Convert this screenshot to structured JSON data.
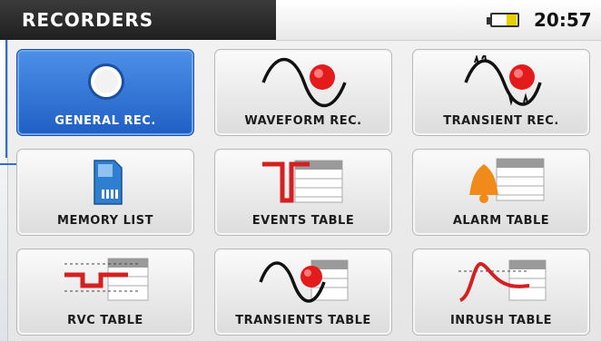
{
  "header": {
    "title": "RECORDERS",
    "time": "20:57",
    "battery_icon": "battery-icon"
  },
  "tiles": [
    {
      "label": "GENERAL REC.",
      "icon": "general-record-icon",
      "selected": true
    },
    {
      "label": "WAVEFORM REC.",
      "icon": "waveform-record-icon"
    },
    {
      "label": "TRANSIENT REC.",
      "icon": "transient-record-icon"
    },
    {
      "label": "MEMORY LIST",
      "icon": "memory-card-icon"
    },
    {
      "label": "EVENTS TABLE",
      "icon": "events-table-icon"
    },
    {
      "label": "ALARM TABLE",
      "icon": "alarm-bell-table-icon"
    },
    {
      "label": "RVC TABLE",
      "icon": "rvc-table-icon"
    },
    {
      "label": "TRANSIENTS TABLE",
      "icon": "transients-table-icon"
    },
    {
      "label": "INRUSH TABLE",
      "icon": "inrush-table-icon"
    }
  ],
  "colors": {
    "selected_tile": "#2f73d6",
    "record_red": "#e31b1b",
    "alarm_orange": "#f08a1a",
    "sd_blue": "#2f7fd0"
  }
}
